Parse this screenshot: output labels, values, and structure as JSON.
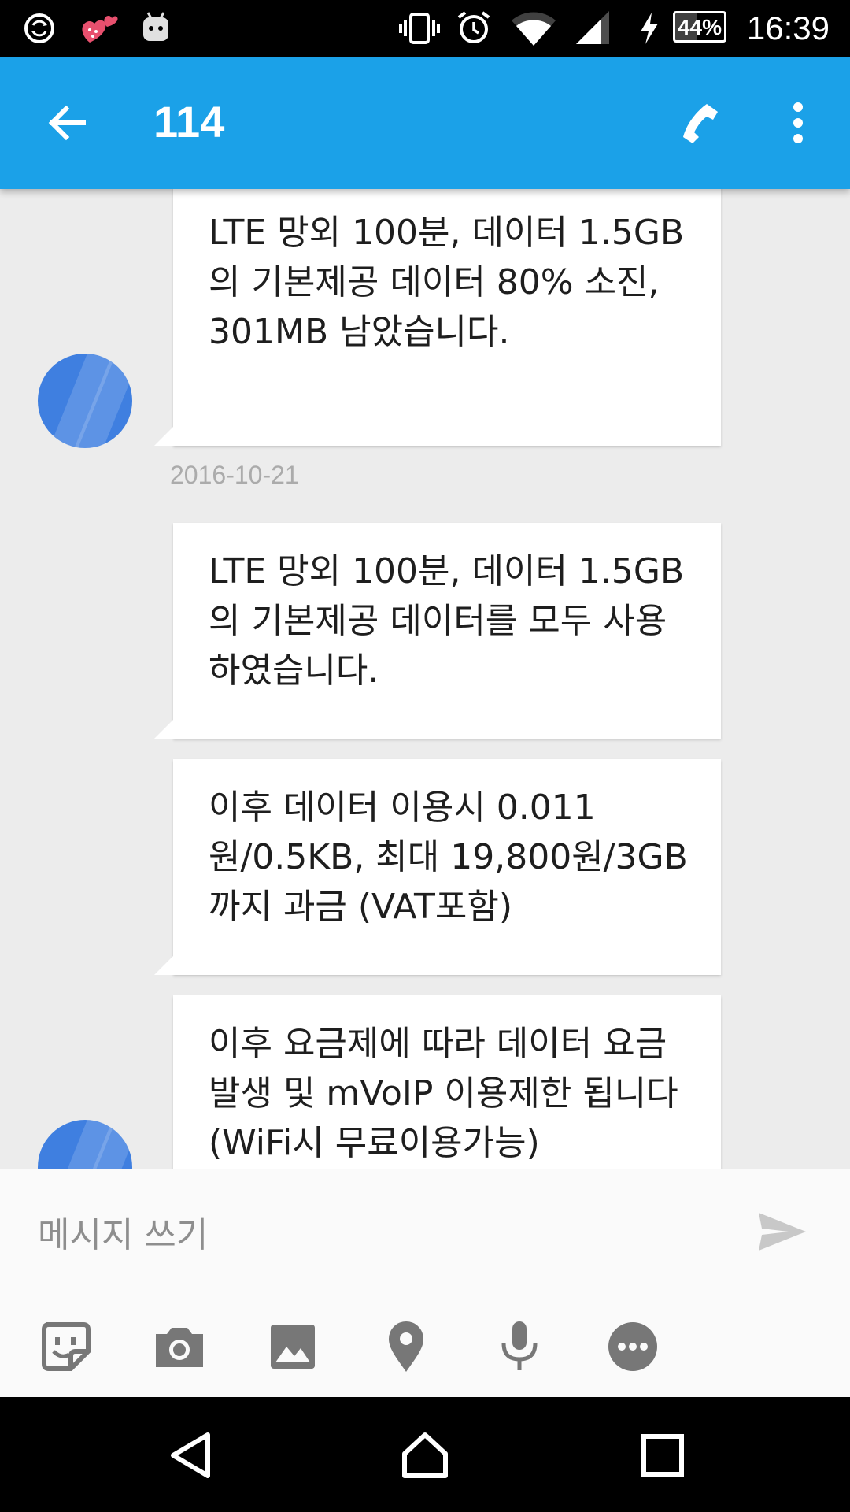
{
  "status_bar": {
    "time": "16:39",
    "battery_percent": "44%",
    "battery_level": 0.44,
    "icons": [
      "sync-icon",
      "heart-sticker-icon",
      "android-icon",
      "vibrate-icon",
      "alarm-icon",
      "wifi-icon",
      "signal-icon",
      "charging-icon",
      "battery-icon"
    ]
  },
  "app_bar": {
    "title": "114",
    "icons": [
      "back-arrow-icon",
      "phone-icon",
      "more-vert-icon"
    ]
  },
  "messages": [
    {
      "text": "LTE 망외 100분, 데이터 1.5GB의 기본제공 데이터 80% 소진, 301MB 남았습니다."
    },
    {
      "date": "2016-10-21"
    },
    {
      "text": "LTE 망외 100분, 데이터 1.5GB의 기본제공 데이터를 모두 사용하였습니다."
    },
    {
      "text": "이후 데이터 이용시 0.011원/0.5KB, 최대 19,800원/3GB까지 과금 (VAT포함)"
    },
    {
      "text": "이후 요금제에 따라 데이터 요금발생 및 mVoIP 이용제한 됩니다(WiFi시 무료이용가능)"
    }
  ],
  "compose": {
    "placeholder": "메시지 쓰기",
    "attachments": [
      "sticker-icon",
      "camera-icon",
      "image-icon",
      "location-icon",
      "microphone-icon",
      "more-options-icon"
    ]
  },
  "nav_bar": {
    "buttons": [
      "back-icon",
      "home-icon",
      "recents-icon"
    ]
  },
  "colors": {
    "app_bar": "#1ba1e8",
    "background": "#ececec",
    "avatar": "#3f7fe0",
    "icon_gray": "#777777"
  }
}
